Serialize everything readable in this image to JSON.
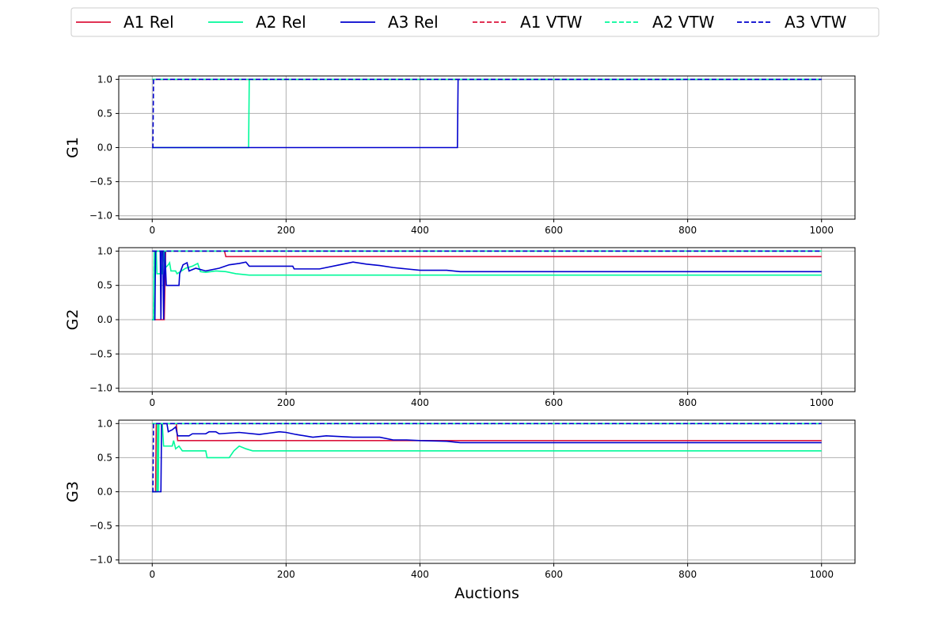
{
  "chart_data": {
    "type": "line",
    "xlabel": "Auctions",
    "x_ticks": [
      0,
      200,
      400,
      600,
      800,
      1000
    ],
    "y_ticks": [
      1.0,
      0.5,
      0.0,
      -0.5,
      -1.0
    ],
    "y_tick_labels": [
      "1.0",
      "0.5",
      "0.0",
      "−0.5",
      "−1.0"
    ],
    "xlim": [
      -50,
      1050
    ],
    "ylim": [
      -1.05,
      1.05
    ],
    "grid": true,
    "legend": {
      "placement": "top-center",
      "entries": [
        {
          "label": "A1 Rel",
          "color": "#dc143c",
          "style": "solid"
        },
        {
          "label": "A2 Rel",
          "color": "#00fa9a",
          "style": "solid"
        },
        {
          "label": "A3 Rel",
          "color": "#0000cd",
          "style": "solid"
        },
        {
          "label": "A1 VTW",
          "color": "#dc143c",
          "style": "dashed"
        },
        {
          "label": "A2 VTW",
          "color": "#00fa9a",
          "style": "dashed"
        },
        {
          "label": "A3 VTW",
          "color": "#0000cd",
          "style": "dashed"
        }
      ]
    },
    "panels": [
      {
        "ylabel": "G1",
        "series": [
          {
            "name": "A1 Rel",
            "color": "#dc143c",
            "style": "solid",
            "points": [
              [
                0,
                1
              ],
              [
                1000,
                1
              ]
            ]
          },
          {
            "name": "A2 Rel",
            "color": "#00fa9a",
            "style": "solid",
            "points": [
              [
                0,
                0
              ],
              [
                144,
                0
              ],
              [
                145,
                1
              ],
              [
                1000,
                1
              ]
            ]
          },
          {
            "name": "A3 Rel",
            "color": "#0000cd",
            "style": "solid",
            "points": [
              [
                0,
                0
              ],
              [
                456,
                0
              ],
              [
                457,
                1
              ],
              [
                1000,
                1
              ]
            ]
          },
          {
            "name": "A1 VTW",
            "color": "#dc143c",
            "style": "dashed",
            "points": [
              [
                0,
                1
              ],
              [
                1000,
                1
              ]
            ]
          },
          {
            "name": "A2 VTW",
            "color": "#00fa9a",
            "style": "dashed",
            "points": [
              [
                0,
                1
              ],
              [
                1000,
                1
              ]
            ]
          },
          {
            "name": "A3 VTW",
            "color": "#0000cd",
            "style": "dashed",
            "points": [
              [
                0,
                0
              ],
              [
                1,
                0
              ],
              [
                2,
                1
              ],
              [
                1000,
                1
              ]
            ]
          }
        ]
      },
      {
        "ylabel": "G2",
        "series": [
          {
            "name": "A1 Rel",
            "color": "#dc143c",
            "style": "solid",
            "points": [
              [
                0,
                0
              ],
              [
                18,
                0
              ],
              [
                20,
                1
              ],
              [
                108,
                1
              ],
              [
                110,
                0.92
              ],
              [
                1000,
                0.92
              ]
            ]
          },
          {
            "name": "A2 Rel",
            "color": "#00fa9a",
            "style": "solid",
            "points": [
              [
                0,
                0
              ],
              [
                2,
                0
              ],
              [
                3,
                1
              ],
              [
                6,
                1
              ],
              [
                7,
                0.67
              ],
              [
                15,
                0.67
              ],
              [
                17,
                1
              ],
              [
                19,
                0.75
              ],
              [
                24,
                0.8
              ],
              [
                26,
                0.83
              ],
              [
                28,
                0.71
              ],
              [
                35,
                0.71
              ],
              [
                37,
                0.67
              ],
              [
                42,
                0.7
              ],
              [
                50,
                0.75
              ],
              [
                60,
                0.78
              ],
              [
                68,
                0.82
              ],
              [
                72,
                0.7
              ],
              [
                80,
                0.69
              ],
              [
                95,
                0.71
              ],
              [
                110,
                0.7
              ],
              [
                125,
                0.67
              ],
              [
                145,
                0.65
              ],
              [
                1000,
                0.65
              ]
            ]
          },
          {
            "name": "A3 Rel",
            "color": "#0000cd",
            "style": "solid",
            "points": [
              [
                0,
                0
              ],
              [
                4,
                0
              ],
              [
                5,
                1
              ],
              [
                12,
                1
              ],
              [
                13,
                0
              ],
              [
                14,
                1
              ],
              [
                16,
                1
              ],
              [
                17,
                0
              ],
              [
                18,
                0.5
              ],
              [
                19,
                1
              ],
              [
                21,
                0.5
              ],
              [
                40,
                0.5
              ],
              [
                41,
                0.67
              ],
              [
                46,
                0.8
              ],
              [
                52,
                0.83
              ],
              [
                55,
                0.71
              ],
              [
                65,
                0.75
              ],
              [
                80,
                0.71
              ],
              [
                100,
                0.75
              ],
              [
                115,
                0.8
              ],
              [
                130,
                0.82
              ],
              [
                140,
                0.84
              ],
              [
                145,
                0.78
              ],
              [
                210,
                0.78
              ],
              [
                212,
                0.74
              ],
              [
                250,
                0.74
              ],
              [
                280,
                0.8
              ],
              [
                300,
                0.84
              ],
              [
                320,
                0.81
              ],
              [
                340,
                0.79
              ],
              [
                360,
                0.76
              ],
              [
                380,
                0.74
              ],
              [
                400,
                0.72
              ],
              [
                440,
                0.72
              ],
              [
                460,
                0.7
              ],
              [
                1000,
                0.7
              ]
            ]
          },
          {
            "name": "A1 VTW",
            "color": "#dc143c",
            "style": "dashed",
            "points": [
              [
                0,
                1
              ],
              [
                1000,
                1
              ]
            ]
          },
          {
            "name": "A2 VTW",
            "color": "#00fa9a",
            "style": "dashed",
            "points": [
              [
                0,
                0
              ],
              [
                2,
                0
              ],
              [
                3,
                1
              ],
              [
                1000,
                1
              ]
            ]
          },
          {
            "name": "A3 VTW",
            "color": "#0000cd",
            "style": "dashed",
            "points": [
              [
                0,
                1
              ],
              [
                1000,
                1
              ]
            ]
          }
        ]
      },
      {
        "ylabel": "G3",
        "series": [
          {
            "name": "A1 Rel",
            "color": "#dc143c",
            "style": "solid",
            "points": [
              [
                0,
                0
              ],
              [
                5,
                0
              ],
              [
                6,
                1
              ],
              [
                36,
                1
              ],
              [
                38,
                0.75
              ],
              [
                1000,
                0.75
              ]
            ]
          },
          {
            "name": "A2 Rel",
            "color": "#00fa9a",
            "style": "solid",
            "points": [
              [
                0,
                0
              ],
              [
                7,
                0
              ],
              [
                8,
                1
              ],
              [
                9,
                0
              ],
              [
                10,
                1
              ],
              [
                15,
                1
              ],
              [
                17,
                0.67
              ],
              [
                30,
                0.67
              ],
              [
                32,
                0.75
              ],
              [
                35,
                0.63
              ],
              [
                40,
                0.67
              ],
              [
                45,
                0.6
              ],
              [
                80,
                0.6
              ],
              [
                82,
                0.5
              ],
              [
                115,
                0.5
              ],
              [
                122,
                0.6
              ],
              [
                130,
                0.67
              ],
              [
                140,
                0.63
              ],
              [
                150,
                0.6
              ],
              [
                1000,
                0.6
              ]
            ]
          },
          {
            "name": "A3 Rel",
            "color": "#0000cd",
            "style": "solid",
            "points": [
              [
                0,
                0
              ],
              [
                13,
                0
              ],
              [
                14,
                1
              ],
              [
                22,
                1
              ],
              [
                24,
                0.88
              ],
              [
                30,
                0.91
              ],
              [
                35,
                0.95
              ],
              [
                38,
                0.82
              ],
              [
                55,
                0.82
              ],
              [
                60,
                0.85
              ],
              [
                80,
                0.85
              ],
              [
                85,
                0.88
              ],
              [
                95,
                0.88
              ],
              [
                100,
                0.85
              ],
              [
                130,
                0.87
              ],
              [
                160,
                0.84
              ],
              [
                175,
                0.86
              ],
              [
                190,
                0.88
              ],
              [
                200,
                0.87
              ],
              [
                215,
                0.84
              ],
              [
                240,
                0.8
              ],
              [
                260,
                0.82
              ],
              [
                300,
                0.8
              ],
              [
                340,
                0.8
              ],
              [
                360,
                0.76
              ],
              [
                380,
                0.76
              ],
              [
                400,
                0.75
              ],
              [
                440,
                0.74
              ],
              [
                460,
                0.72
              ],
              [
                1000,
                0.72
              ]
            ]
          },
          {
            "name": "A1 VTW",
            "color": "#dc143c",
            "style": "dashed",
            "points": [
              [
                0,
                1
              ],
              [
                1000,
                1
              ]
            ]
          },
          {
            "name": "A2 VTW",
            "color": "#00fa9a",
            "style": "dashed",
            "points": [
              [
                0,
                1
              ],
              [
                1000,
                1
              ]
            ]
          },
          {
            "name": "A3 VTW",
            "color": "#0000cd",
            "style": "dashed",
            "points": [
              [
                0,
                0
              ],
              [
                1,
                0
              ],
              [
                2,
                1
              ],
              [
                1000,
                1
              ]
            ]
          }
        ]
      }
    ]
  }
}
